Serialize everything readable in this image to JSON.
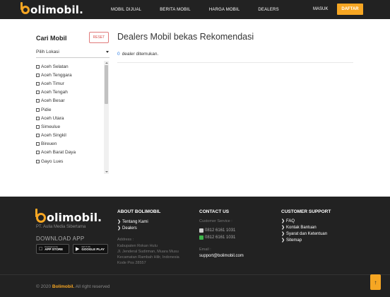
{
  "header": {
    "logo_text": "olimobil.",
    "nav": [
      "MOBIL DIJUAL",
      "BERITA MOBIL",
      "HARGA MOBIL",
      "DEALERS"
    ],
    "login": "MASUK",
    "register": "DAFTAR"
  },
  "sidebar": {
    "title": "Cari Mobil",
    "reset": "RESET",
    "location_select": "Pilih Lokasi",
    "locations": [
      "Aceh Selatan",
      "Aceh Tenggara",
      "Aceh Timur",
      "Aceh Tengah",
      "Aceh Besar",
      "Pidie",
      "Aceh Utara",
      "Simeulue",
      "Aceh Singkil",
      "Bireuen",
      "Aceh Barat Daya",
      "Gayo Lues"
    ]
  },
  "main": {
    "title": "Dealers Mobil bekas Rekomendasi",
    "dealer_count": "0",
    "dealer_text": "dealer ditemukan."
  },
  "footer": {
    "logo_text": "olimobil.",
    "company": "PT. Aulia Media Sibertama",
    "download": "DOWNLOAD APP",
    "app_store_small": "Download on the",
    "app_store_big": "APP STORE",
    "play_small": "GET IT ON",
    "play_big": "GOOGLE PLAY",
    "about_title": "ABOUT BOLIMOBIL",
    "about_links": [
      "Tentang Kami",
      "Dealers"
    ],
    "address_label": "Address :",
    "address_lines": [
      "Kabupaten Rokan Hulu",
      "Jl. Jenderal Sudirman, Muara Musu",
      "Kecamatan Rambah Hilir, Indonesia",
      "Kode Pos 28557"
    ],
    "contact_title": "CONTACT US",
    "service_label": "Customer Service :",
    "phone1": "0812 6161 1031",
    "phone2": "0812 6161 1031",
    "email_label": "Email :",
    "email": "support@bolimobil.com",
    "support_title": "CUSTOMER SUPPORT",
    "support_links": [
      "FAQ",
      "Kontak Bantuan",
      "Syarat dan Ketentuan",
      "Sitemap"
    ],
    "copyright_prefix": "© 2020",
    "copyright_brand": "Bolimobil.",
    "copyright_suffix": "All right reserved",
    "back_to_top": "↑"
  },
  "colors": {
    "accent": "#f6a623",
    "dark": "#222222",
    "link_blue": "#2a7be4",
    "reset_red": "#d9534f"
  }
}
